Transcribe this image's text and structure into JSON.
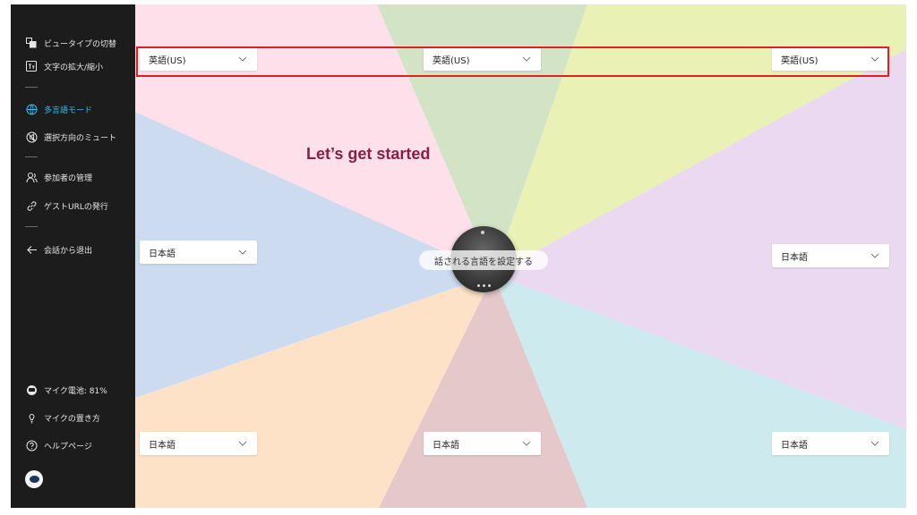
{
  "sidebar": {
    "items": [
      {
        "label": "ビュータイプの切替",
        "icon": "view-switch-icon"
      },
      {
        "label": "文字の拡大/縮小",
        "icon": "text-size-icon"
      },
      {
        "label": "多言語モード",
        "icon": "multilingual-icon",
        "active": true
      },
      {
        "label": "選択方向のミュート",
        "icon": "mute-direction-icon"
      },
      {
        "label": "参加者の管理",
        "icon": "participants-icon"
      },
      {
        "label": "ゲストURLの発行",
        "icon": "link-icon"
      },
      {
        "label": "会話から退出",
        "icon": "exit-arrow-icon"
      },
      {
        "label": "マイク電池: 81%",
        "icon": "battery-device-icon"
      },
      {
        "label": "マイクの置き方",
        "icon": "mic-placement-icon"
      },
      {
        "label": "ヘルプページ",
        "icon": "help-icon"
      }
    ],
    "active_color": "#3fb6e6"
  },
  "main": {
    "heading": "Let’s get started",
    "center_label": "話される言語を設定する",
    "selects": {
      "top_left": "英語(US)",
      "top_center": "英語(US)",
      "top_right": "英語(US)",
      "mid_left": "日本語",
      "mid_right": "日本語",
      "bottom_left": "日本語",
      "bottom_center": "日本語",
      "bottom_right": "日本語"
    },
    "sector_colors": [
      "#fde0ea",
      "#d2e3c6",
      "#e9f2b4",
      "#ead9f0",
      "#cdebef",
      "#e5c8c9",
      "#fde2c8",
      "#cddbf1"
    ],
    "highlight_color": "#e02020"
  }
}
